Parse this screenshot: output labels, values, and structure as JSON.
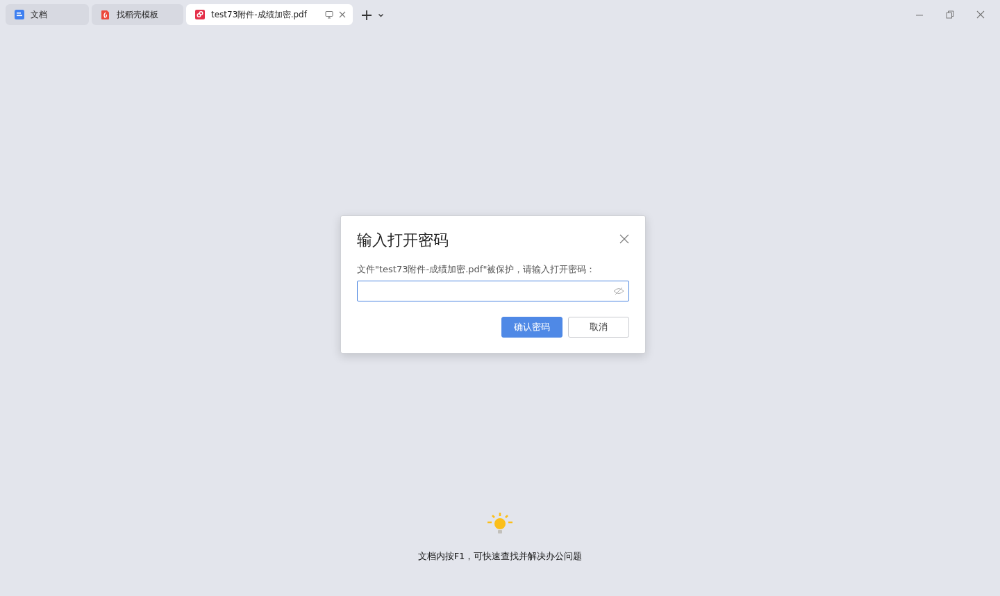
{
  "tabs": [
    {
      "label": "文档",
      "selected": false,
      "kind": "docs"
    },
    {
      "label": "找稻壳模板",
      "selected": false,
      "kind": "template"
    },
    {
      "label": "test73附件-成绩加密.pdf",
      "selected": true,
      "kind": "pdf"
    }
  ],
  "dialog": {
    "title": "输入打开密码",
    "message": "文件\"test73附件-成绩加密.pdf\"被保护，请输入打开密码：",
    "password_field": {
      "focused": true
    },
    "buttons": [
      {
        "label": "确认密码",
        "kind": "primary"
      },
      {
        "label": "取消",
        "kind": "secondary"
      }
    ]
  },
  "tip": "文档内按F1，可快速查找并解决办公问题"
}
